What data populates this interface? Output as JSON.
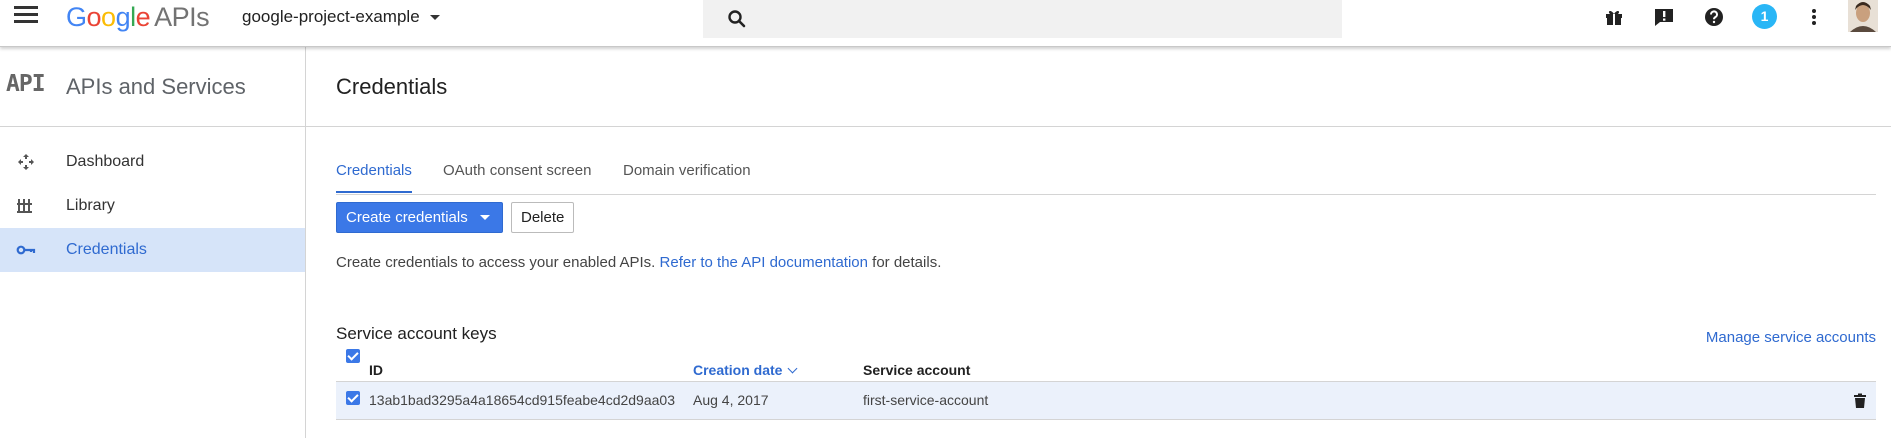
{
  "topbar": {
    "logo_google": "Google",
    "logo_apis": "APIs",
    "project": "google-project-example",
    "notification_count": "1",
    "icons": [
      "menu-icon",
      "search-icon",
      "gift-icon",
      "feedback-icon",
      "help-icon",
      "more-vert-icon",
      "avatar"
    ]
  },
  "sidebar": {
    "logo_text": "API",
    "title": "APIs and Services",
    "items": [
      {
        "label": "Dashboard",
        "icon": "dashboard-icon"
      },
      {
        "label": "Library",
        "icon": "library-icon"
      },
      {
        "label": "Credentials",
        "icon": "key-icon",
        "active": true
      }
    ]
  },
  "main": {
    "title": "Credentials",
    "tabs": [
      {
        "label": "Credentials",
        "active": true
      },
      {
        "label": "OAuth consent screen"
      },
      {
        "label": "Domain verification"
      }
    ],
    "create_button": "Create credentials",
    "delete_button": "Delete",
    "info_prefix": "Create credentials to access your enabled APIs.",
    "info_link": "Refer to the API documentation",
    "info_suffix": "for details.",
    "section_title": "Service account keys",
    "manage_link": "Manage service accounts",
    "table": {
      "headers": {
        "id": "ID",
        "creation_date": "Creation date",
        "service_account": "Service account"
      },
      "rows": [
        {
          "id": "13ab1bad3295a4a18654cd915feabe4cd2d9aa03",
          "creation_date": "Aug 4, 2017",
          "service_account": "first-service-account",
          "checked": true
        }
      ]
    }
  },
  "colors": {
    "accent": "#3b78e7",
    "link": "#2f6ad0",
    "active_bg": "#d6e4f9",
    "row_bg": "#ebf1fb",
    "notification": "#29b6f6"
  }
}
